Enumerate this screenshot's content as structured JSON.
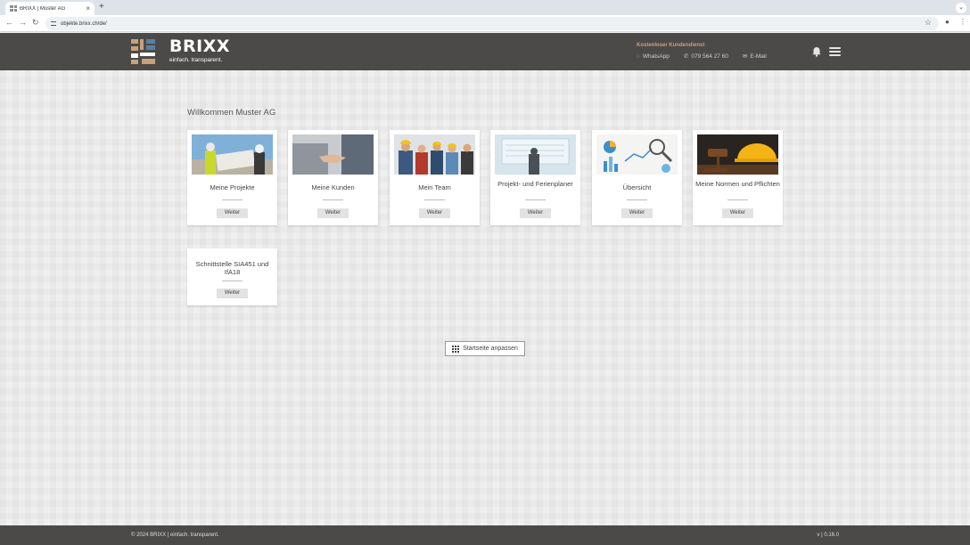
{
  "browser": {
    "tab_title": "BRIXX | Muster AG",
    "tab_close": "×",
    "new_tab": "+",
    "url": "objekte.brixx.ch/de/"
  },
  "header": {
    "brand": "BRIXX",
    "tagline": "einfach. transparent.",
    "support_title": "Kostenloser Kundendienst",
    "whatsapp": "WhatsApp",
    "phone": "079 564 27 60",
    "email": "E-Mail",
    "colors": {
      "bar": "#4b4a48",
      "accent": "#c8a17a"
    }
  },
  "main": {
    "welcome": "Willkommen Muster AG",
    "cards": [
      {
        "title": "Meine Projekte",
        "button": "Weiter",
        "image": "construction-workers-with-plan"
      },
      {
        "title": "Meine Kunden",
        "button": "Weiter",
        "image": "handshake"
      },
      {
        "title": "Mein Team",
        "button": "Weiter",
        "image": "team-with-hardhats"
      },
      {
        "title": "Projekt- und Ferienplaner",
        "button": "Weiter",
        "image": "person-at-planning-board"
      },
      {
        "title": "Übersicht",
        "button": "Weiter",
        "image": "charts-and-magnifier"
      },
      {
        "title": "Meine Normen und Pflichten",
        "button": "Weiter",
        "image": "gavel-and-hardhat"
      },
      {
        "title": "Schnittstelle SIA451 und IfA18",
        "button": "Weiter"
      }
    ],
    "customize_button": "Startseite anpassen"
  },
  "footer": {
    "copyright": "© 2024 BRIXX | einfach. transparent.",
    "version": "v | 0.16.0"
  }
}
